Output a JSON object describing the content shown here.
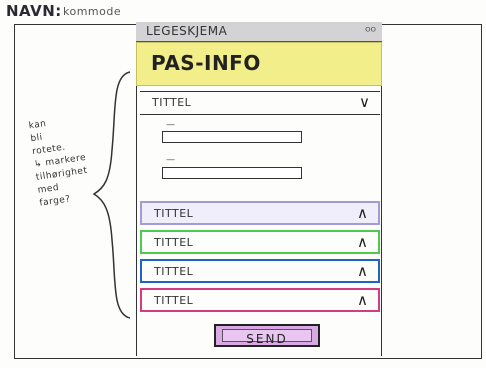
{
  "header": {
    "name_label": "NAVN:",
    "name_value": "kommode"
  },
  "phone": {
    "topbar_title": "LEGESKJEMA",
    "topbar_icons": "ᴼᴼ",
    "page_title": "PAS-INFO",
    "sections": [
      {
        "label": "TITTEL",
        "state": "open",
        "chevron": "∨"
      },
      {
        "label": "TITTEL",
        "state": "collapsed",
        "chevron": "∧"
      },
      {
        "label": "TITTEL",
        "state": "collapsed",
        "chevron": "∧"
      },
      {
        "label": "TITTEL",
        "state": "collapsed",
        "chevron": "∧"
      },
      {
        "label": "TITTEL",
        "state": "collapsed",
        "chevron": "∧"
      }
    ],
    "fields": [
      {
        "label": "—"
      },
      {
        "label": "—"
      }
    ],
    "send_label": "SEND"
  },
  "annotation": {
    "lines": [
      "kan",
      "bli",
      "rotete.",
      "↳ markere",
      "tilhørighet",
      "med",
      "farge?"
    ]
  },
  "colors": {
    "yellow": "#f2ee8a",
    "purple": "#a49bd4",
    "green": "#4dcb4d",
    "blue": "#1f63c9",
    "pink": "#d43c82",
    "send": "#d9a8e5"
  }
}
